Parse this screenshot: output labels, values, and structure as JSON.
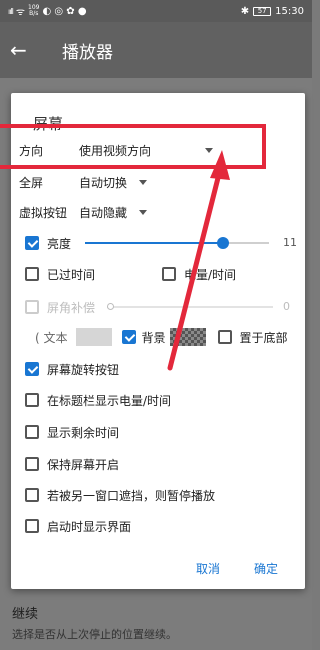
{
  "status": {
    "signal": "ııll",
    "wifi": "ᯤ",
    "speed_top": "109",
    "speed_bottom": "B/s",
    "right_icons": "✱",
    "battery": "57",
    "time": "15:30"
  },
  "appbar": {
    "title": "播放器"
  },
  "background": {
    "item_title": "继续",
    "item_subtitle": "选择是否从上次停止的位置继续。"
  },
  "dialog": {
    "title": "屏幕",
    "orientation": {
      "label": "方向",
      "value": "使用视频方向"
    },
    "fullscreen": {
      "label": "全屏",
      "value": "自动切换"
    },
    "soft_buttons": {
      "label": "虚拟按钮",
      "value": "自动隐藏"
    },
    "brightness": {
      "label": "亮度",
      "checked": true,
      "value": "11",
      "level": 0.75
    },
    "elapsed_time": {
      "label": "已过时间",
      "checked": false
    },
    "battery_time": {
      "label": "电量/时间",
      "checked": false
    },
    "corner_offset": {
      "label": "屏角补偿",
      "value": "0",
      "disabled": true
    },
    "text_label": "( 文本",
    "background_label": "背景",
    "bottom_label": "置于底部",
    "checks": [
      {
        "label": "屏幕旋转按钮",
        "checked": true
      },
      {
        "label": "在标题栏显示电量/时间",
        "checked": false
      },
      {
        "label": "显示剩余时间",
        "checked": false
      },
      {
        "label": "保持屏幕开启",
        "checked": false
      },
      {
        "label": "若被另一窗口遮挡，则暂停播放",
        "checked": false
      },
      {
        "label": "启动时显示界面",
        "checked": false
      }
    ],
    "cancel": "取消",
    "ok": "确定"
  },
  "colors": {
    "accent": "#1976d2",
    "annotation": "#e3283b"
  }
}
